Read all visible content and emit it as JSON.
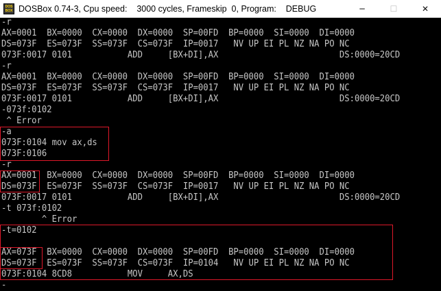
{
  "window": {
    "icon_text_top": "DOS",
    "icon_text_bottom": "BOX",
    "title": "DOSBox 0.74-3, Cpu speed:    3000 cycles, Frameskip  0, Program:    DEBUG",
    "minimize_glyph": "─",
    "maximize_glyph": "☐",
    "close_glyph": "✕"
  },
  "console": {
    "lines": [
      "-r",
      "AX=0001  BX=0000  CX=0000  DX=0000  SP=00FD  BP=0000  SI=0000  DI=0000",
      "DS=073F  ES=073F  SS=073F  CS=073F  IP=0017   NV UP EI PL NZ NA PO NC",
      "073F:0017 0101           ADD     [BX+DI],AX                        DS:0000=20CD",
      "-r",
      "AX=0001  BX=0000  CX=0000  DX=0000  SP=00FD  BP=0000  SI=0000  DI=0000",
      "DS=073F  ES=073F  SS=073F  CS=073F  IP=0017   NV UP EI PL NZ NA PO NC",
      "073F:0017 0101           ADD     [BX+DI],AX                        DS:0000=20CD",
      "-073f:0102",
      " ^ Error",
      "-a",
      "073F:0104 mov ax,ds",
      "073F:0106",
      "-r",
      "AX=0001  BX=0000  CX=0000  DX=0000  SP=00FD  BP=0000  SI=0000  DI=0000",
      "DS=073F  ES=073F  SS=073F  CS=073F  IP=0017   NV UP EI PL NZ NA PO NC",
      "073F:0017 0101           ADD     [BX+DI],AX                        DS:0000=20CD",
      "-t 073f:0102",
      "        ^ Error",
      "-t=0102",
      "",
      "AX=073F  BX=0000  CX=0000  DX=0000  SP=00FD  BP=0000  SI=0000  DI=0000",
      "DS=073F  ES=073F  SS=073F  CS=073F  IP=0104   NV UP EI PL NZ NA PO NC",
      "073F:0104 8CD8           MOV     AX,DS",
      "-"
    ]
  },
  "colors": {
    "text": "#c6c6c6",
    "background": "#000000",
    "highlight": "#e0182a"
  }
}
